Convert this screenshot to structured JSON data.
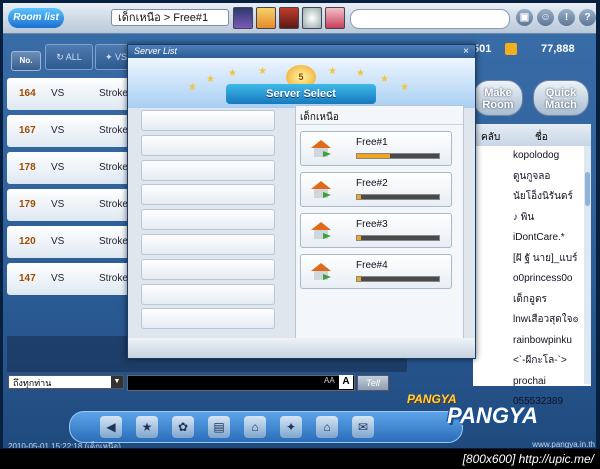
{
  "topbar": {
    "logo": "Room list",
    "breadcrumb": "เด็กเหนือ > Free#1"
  },
  "filters": {
    "no_label": "No.",
    "all_label": "ALL",
    "vs_label": "VS"
  },
  "rooms": [
    {
      "num": "164",
      "vs": "VS",
      "mode": "Stroke"
    },
    {
      "num": "167",
      "vs": "VS",
      "mode": "Stroke"
    },
    {
      "num": "178",
      "vs": "VS",
      "mode": "Stroke"
    },
    {
      "num": "179",
      "vs": "VS",
      "mode": "Stroke"
    },
    {
      "num": "120",
      "vs": "VS",
      "mode": "Stroke"
    },
    {
      "num": "147",
      "vs": "VS",
      "mode": "Stroke"
    }
  ],
  "score": {
    "pang": "501",
    "cookie": "77,888"
  },
  "right_buttons": {
    "make": "Make Room",
    "quick": "Quick Match"
  },
  "players": {
    "col1": "คลับ",
    "col2": "ชื่อ",
    "rows": [
      "kopolodog",
      "ดูนกูจลอ",
      "นัยโอ็งนิรันดร์",
      "♪ พิน",
      "iDontCare.*",
      "[ฝั ฐั นาย]_แบร์",
      "o0princess0o",
      "เด็กอูตร",
      "lnwเสือวสุดใจ๏",
      "rainbowpinku",
      "<`-ผีกะโล-`>",
      "prochai",
      "055532389"
    ]
  },
  "chat": {
    "select": "ถึงทุกท่าน",
    "aa": "AA",
    "a_btn": "A",
    "tell": "Tell"
  },
  "modal": {
    "title": "Server List",
    "close": "×",
    "banner": "Server Select",
    "region": "เด็กเหนือ",
    "servers": [
      {
        "name": "Free#1",
        "load": 0.4,
        "icon_color": "#4aa83a"
      },
      {
        "name": "Free#2",
        "load": 0.05,
        "icon_color": "#4aa83a"
      },
      {
        "name": "Free#3",
        "load": 0.05,
        "icon_color": "#4aa83a"
      },
      {
        "name": "Free#4",
        "load": 0.05,
        "icon_color": "#4aa83a"
      }
    ]
  },
  "dock": {
    "brand": "PANGYA",
    "brand2": "PANGYA"
  },
  "status": {
    "timestamp": "2010-05-01 15:22:18 (เด็กเหนือ)",
    "site": "www.pangya.in.th"
  },
  "footer": "[800x600] http://upic.me/"
}
